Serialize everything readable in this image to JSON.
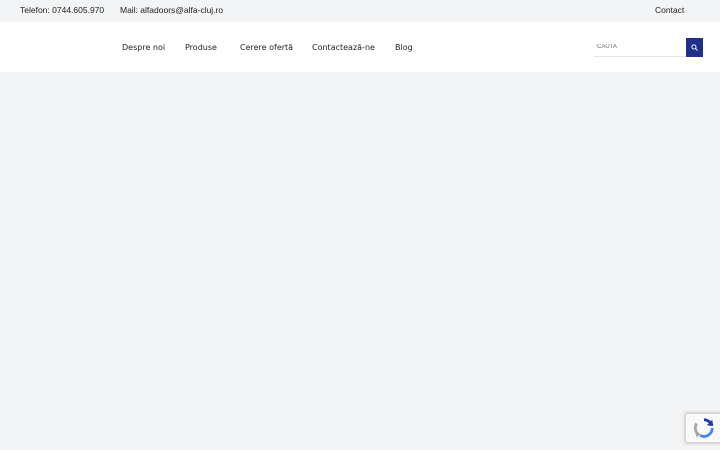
{
  "topbar": {
    "phone": "Telefon: 0744.605.970",
    "mail": "Mail: alfadoors@alfa-cluj.ro",
    "contact_link": "Contact"
  },
  "nav": {
    "items": [
      {
        "label": "Despre noi"
      },
      {
        "label": "Produse"
      },
      {
        "label": "Cerere ofertă"
      },
      {
        "label": "Contactează-ne"
      },
      {
        "label": "Blog"
      }
    ]
  },
  "search": {
    "placeholder": "CAUTA",
    "button_icon": "search-icon",
    "button_color": "#1e2f8c"
  },
  "recaptcha_badge": {
    "icon": "recaptcha-logo-icon"
  },
  "colors": {
    "page_background": "#f3f4f5",
    "header_background": "#ffffff",
    "accent": "#1e2f8c"
  }
}
